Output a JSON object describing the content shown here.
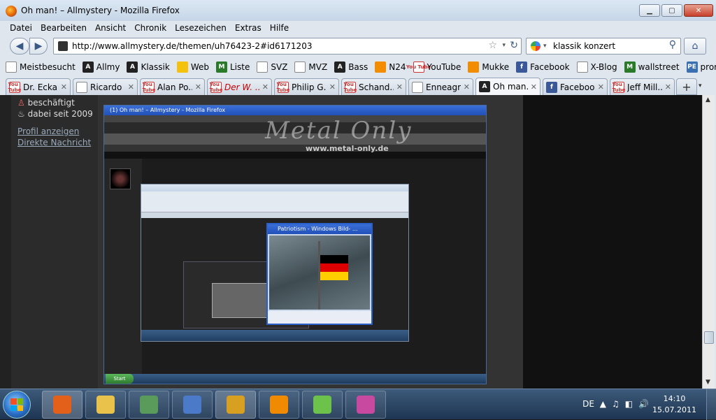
{
  "window": {
    "title": "Oh man! – Allmystery - Mozilla Firefox",
    "controls": {
      "minimize": "▁",
      "maximize": "▢",
      "close": "✕"
    }
  },
  "menubar": [
    "Datei",
    "Bearbeiten",
    "Ansicht",
    "Chronik",
    "Lesezeichen",
    "Extras",
    "Hilfe"
  ],
  "navbar": {
    "back": "◀",
    "forward": "▶",
    "url": "http://www.allmystery.de/themen/uh76423-2#id6171203",
    "star": "☆",
    "dropdown": "▾",
    "reload": "↻",
    "search_query": "klassik konzert",
    "search_icon": "⚲",
    "home": "⌂"
  },
  "bookmarks": [
    {
      "label": "Meistbesucht",
      "icon": "page"
    },
    {
      "label": "Allmy",
      "icon": "dark"
    },
    {
      "label": "Klassik",
      "icon": "dark"
    },
    {
      "label": "Web",
      "icon": "yellow"
    },
    {
      "label": "Liste",
      "icon": "green"
    },
    {
      "label": "SVZ",
      "icon": "page"
    },
    {
      "label": "MVZ",
      "icon": "page"
    },
    {
      "label": "Bass",
      "icon": "dark"
    },
    {
      "label": "N24",
      "icon": "orange"
    },
    {
      "label": "YouTube",
      "icon": "yt"
    },
    {
      "label": "Mukke",
      "icon": "orange"
    },
    {
      "label": "Facebook",
      "icon": "fb"
    },
    {
      "label": "X-Blog",
      "icon": "page"
    },
    {
      "label": "wallstreet",
      "icon": "green"
    },
    {
      "label": "promo",
      "icon": "blue"
    }
  ],
  "icon_text": {
    "yt": "You Tube",
    "fb": "f",
    "dark": "A",
    "green": "M",
    "blue": "PE"
  },
  "tabs": [
    {
      "label": "Dr. Ecka...",
      "icon": "yt",
      "style": ""
    },
    {
      "label": "Ricardo ...",
      "icon": "page",
      "style": ""
    },
    {
      "label": "Alan Po...",
      "icon": "yt",
      "style": ""
    },
    {
      "label": "Der W. ...",
      "icon": "yt",
      "style": "red"
    },
    {
      "label": "Philip G...",
      "icon": "yt",
      "style": ""
    },
    {
      "label": "Schand...",
      "icon": "yt",
      "style": ""
    },
    {
      "label": "Enneagr...",
      "icon": "page",
      "style": ""
    },
    {
      "label": "Oh man...",
      "icon": "dark",
      "style": "active"
    },
    {
      "label": "Facebook",
      "icon": "fb",
      "style": ""
    },
    {
      "label": "Jeff Mill...",
      "icon": "yt",
      "style": ""
    }
  ],
  "tab_close": "✕",
  "new_tab": "+",
  "tab_list": "▾",
  "profile": {
    "status_symbol": "♙",
    "status": "beschäftigt",
    "since_symbol": "♨",
    "since": "dabei seit 2009",
    "link_profile": "Profil anzeigen",
    "link_message": "Direkte Nachricht"
  },
  "nested": {
    "title": "(1) Oh man! – Allmystery - Mozilla Firefox",
    "metal_text": "Metal Only",
    "metal_url": "www.metal-only.de",
    "start_label": "Start",
    "player_title": "Patriotism - Windows Bild- ...",
    "flag_colors": [
      "#000000",
      "#dd0000",
      "#ffce00"
    ]
  },
  "taskbar": {
    "language": "DE",
    "tray_icons": [
      "▲",
      "♫",
      "◧",
      "🔊"
    ],
    "time": "14:10",
    "date": "15.07.2011",
    "apps": [
      {
        "name": "firefox",
        "color": "#e2601a",
        "active": true
      },
      {
        "name": "explorer",
        "color": "#e8c24a",
        "active": false
      },
      {
        "name": "network",
        "color": "#5a9a5a",
        "active": false
      },
      {
        "name": "thunderbird",
        "color": "#4a7ac8",
        "active": false
      },
      {
        "name": "winamp",
        "color": "#d8a020",
        "active": true
      },
      {
        "name": "vlc",
        "color": "#f08a00",
        "active": false
      },
      {
        "name": "icq",
        "color": "#6cc24a",
        "active": false
      },
      {
        "name": "paint",
        "color": "#c84aa0",
        "active": false
      }
    ]
  }
}
